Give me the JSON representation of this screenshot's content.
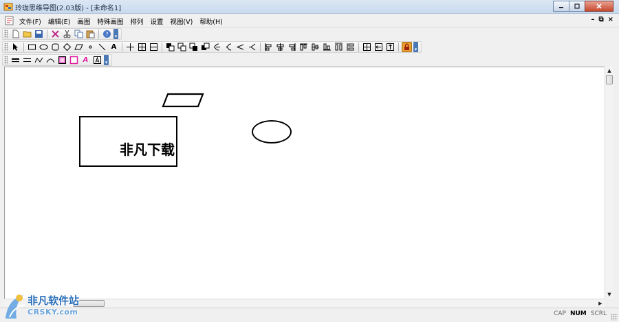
{
  "window": {
    "title": "玲珑思维导图(2.03版) - [未命名1]",
    "controls": [
      "minimize",
      "maximize",
      "close"
    ]
  },
  "menubar": {
    "items": [
      {
        "label": "文件(F)"
      },
      {
        "label": "编辑(E)"
      },
      {
        "label": "画图"
      },
      {
        "label": "特殊画图"
      },
      {
        "label": "排列"
      },
      {
        "label": "设置"
      },
      {
        "label": "视图(V)"
      },
      {
        "label": "帮助(H)"
      }
    ],
    "mdi_controls": [
      "–",
      "⧉",
      "×"
    ]
  },
  "toolbars": {
    "standard": [
      "new-icon",
      "open-icon",
      "save-icon",
      "cut-icon",
      "scissors-icon",
      "copy-icon",
      "paste-icon",
      "help-icon"
    ],
    "shapes": [
      "pointer-icon",
      "rectangle-icon",
      "ellipse-icon",
      "rounded-rect-icon",
      "diamond-icon",
      "parallelogram-icon",
      "dot-icon",
      "line-icon",
      "text-icon",
      "cross-icon",
      "grid-icon",
      "split-icon",
      "bring-front-icon",
      "send-back-icon",
      "align-icons",
      "lock-icon"
    ],
    "format": [
      "line-weight-icon",
      "double-line-icon",
      "curve-icon",
      "arc-icon",
      "fill-color-icon",
      "border-color-icon",
      "font-color-icon",
      "text-box-icon"
    ],
    "text_labels": {
      "text_tool": "A",
      "font_color": "A"
    }
  },
  "canvas": {
    "shapes": [
      {
        "type": "rectangle",
        "text": "非凡下载"
      },
      {
        "type": "parallelogram",
        "text": ""
      },
      {
        "type": "ellipse",
        "text": ""
      }
    ]
  },
  "statusbar": {
    "panels": [
      {
        "label": "CAP",
        "active": false
      },
      {
        "label": "NUM",
        "active": true
      },
      {
        "label": "SCRL",
        "active": false
      }
    ]
  },
  "watermark": {
    "line1": "非凡软件站",
    "line2": "CRSKY.com"
  },
  "colors": {
    "accent": "#4a78b5",
    "lock": "#e8a030",
    "canvas": "#ffffff",
    "watermark": "#2b6fb8"
  }
}
